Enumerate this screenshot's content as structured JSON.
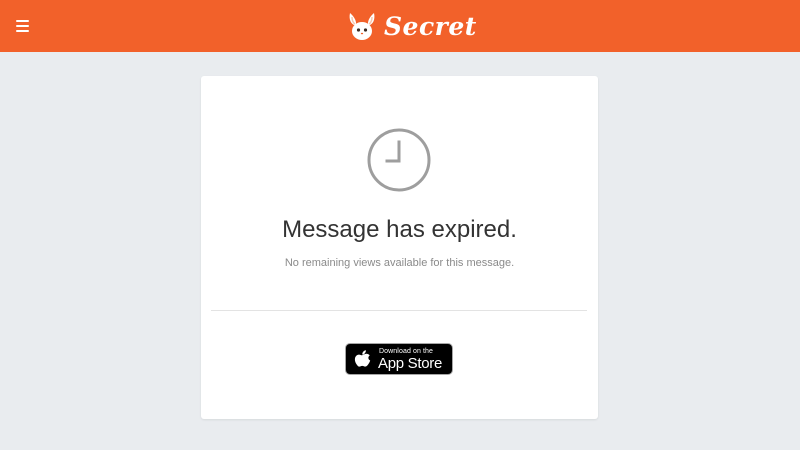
{
  "header": {
    "brand": "Secret",
    "menu_icon": "hamburger-menu-icon",
    "logo_icon": "bunny-mascot-icon",
    "background": "#f2612a"
  },
  "message": {
    "icon": "clock-icon",
    "title": "Message has expired.",
    "subtitle": "No remaining views available for this message."
  },
  "app_store_badge": {
    "icon": "apple-logo-icon",
    "line1": "Download on the",
    "line2": "App Store"
  }
}
